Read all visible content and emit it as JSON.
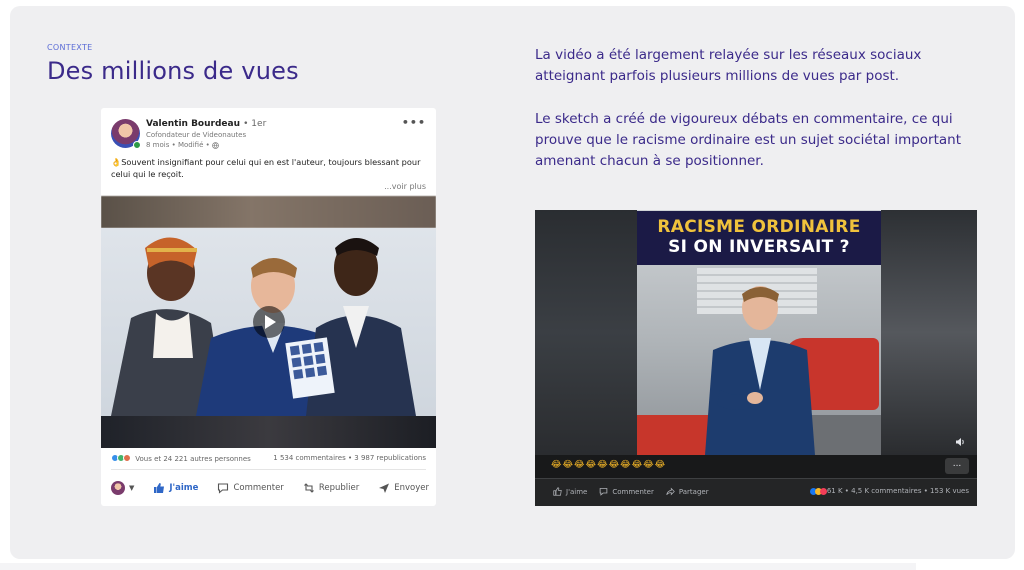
{
  "section": {
    "eyebrow": "CONTEXTE",
    "title": "Des millions de vues"
  },
  "description": {
    "paragraph1": "La vidéo a été largement relayée sur les réseaux sociaux atteignant parfois plusieurs millions de vues par post.",
    "paragraph2": "Le sketch a créé de vigoureux débats en commentaire, ce qui prouve que le racisme ordinaire est un sujet sociétal important amenant chacun à se positionner."
  },
  "linkedin_post": {
    "author_name": "Valentin Bourdeau",
    "degree": "• 1er",
    "author_title": "Cofondateur de Videonautes",
    "meta": "8 mois • Modifié •",
    "text": "👌Souvent insignifiant pour celui qui en est l'auteur, toujours blessant pour celui qui le reçoit.",
    "see_more": "...voir plus",
    "menu": "•••",
    "reactions_text": "Vous et 24 221 autres personnes",
    "stats_text": "1 534 commentaires • 3 987 republications",
    "actions": {
      "like": "J'aime",
      "comment": "Commenter",
      "repost": "Republier",
      "send": "Envoyer"
    },
    "colors": {
      "like_blue": "#2f67c7",
      "online_green": "#2e9a47"
    }
  },
  "facebook_video": {
    "banner_line1": "RACISME ORDINAIRE",
    "banner_line2": "SI ON INVERSAIT ?",
    "emojis": "😂😂😂😂😂😂😂😂😂😂",
    "more": "...",
    "actions": {
      "like": "J'aime",
      "comment": "Commenter",
      "share": "Partager"
    },
    "stats_text": "61 K • 4,5 K commentaires • 153 K vues",
    "colors": {
      "banner_bg": "#1b1a46",
      "banner_yellow": "#f0c23c"
    }
  }
}
